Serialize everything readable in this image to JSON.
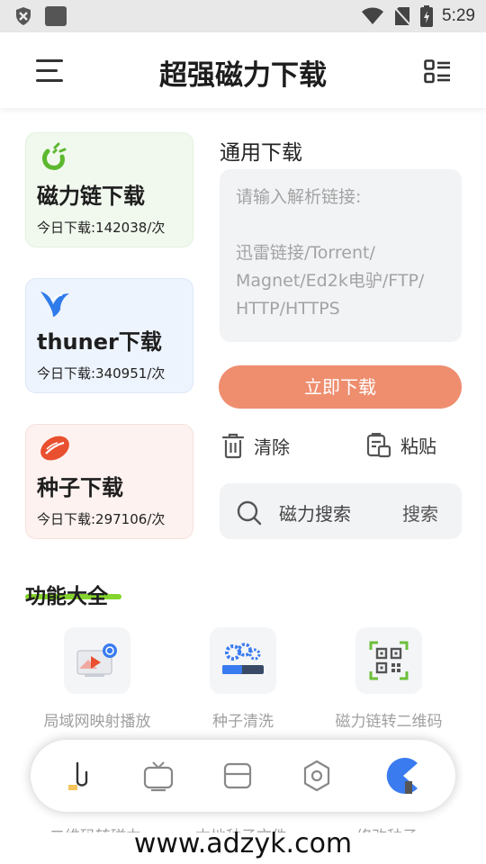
{
  "status_bar": {
    "time": "5:29"
  },
  "header": {
    "title": "超强磁力下载"
  },
  "cards": [
    {
      "title": "磁力链下载",
      "count": "今日下载:142038/次",
      "icon": "magnet-icon"
    },
    {
      "title": "thuner下载",
      "count": "今日下载:340951/次",
      "icon": "bird-icon"
    },
    {
      "title": "种子下载",
      "count": "今日下载:297106/次",
      "icon": "seed-icon"
    }
  ],
  "general": {
    "label": "通用下载",
    "input_placeholder_1": "请输入解析链接:",
    "input_placeholder_2": "迅雷链接/Torrent/",
    "input_placeholder_3": "Magnet/Ed2k电驴/FTP/",
    "input_placeholder_4": "HTTP/HTTPS",
    "download_button": "立即下载",
    "clear": "清除",
    "paste": "粘贴"
  },
  "search": {
    "placeholder": "磁力搜索",
    "button": "搜索"
  },
  "features": {
    "title": "功能大全",
    "items": [
      {
        "label": "局域网映射播放",
        "icon": "screen-cast-icon"
      },
      {
        "label": "种子清洗",
        "icon": "gears-icon"
      },
      {
        "label": "磁力链转二维码",
        "icon": "qr-code-icon"
      }
    ],
    "partial_labels": [
      "二维码转磁力",
      "本地种子文件",
      "修改种子"
    ]
  },
  "bottom_nav": [
    "link-icon",
    "tv-icon",
    "window-icon",
    "settings-icon",
    "pacman-icon"
  ],
  "colors": {
    "accent": "#ee8e6f",
    "green": "#85d42d",
    "blue": "#3a7bf0",
    "red": "#e8502f"
  },
  "watermark": "www.adzyk.com"
}
